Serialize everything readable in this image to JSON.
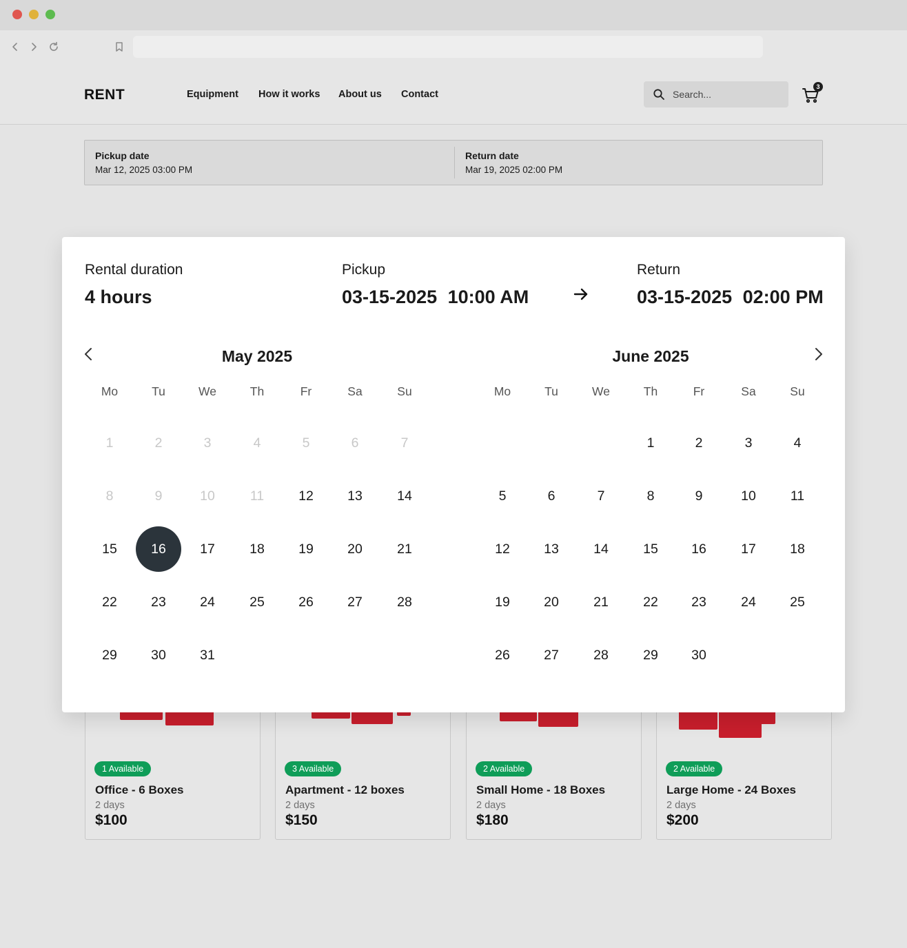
{
  "browser": {
    "colors": {
      "close": "#e0564f",
      "minimize": "#e0b23a",
      "maximize": "#5dbb4f"
    },
    "icons": [
      "back-icon",
      "forward-icon",
      "reload-icon",
      "bookmark-icon"
    ]
  },
  "header": {
    "logo": "RENT",
    "nav": [
      "Equipment",
      "How it works",
      "About us",
      "Contact"
    ],
    "search_placeholder": "Search...",
    "cart_count": "3"
  },
  "booking": {
    "pickup_label": "Pickup date",
    "pickup_value": "Mar 12, 2025 03:00 PM",
    "return_label": "Return date",
    "return_value": "Mar 19, 2025 02:00 PM"
  },
  "picker": {
    "duration_label": "Rental duration",
    "duration_value": "4 hours",
    "pickup_label": "Pickup",
    "pickup_date": "03-15-2025",
    "pickup_time": "10:00 AM",
    "return_label": "Return",
    "return_date": "03-15-2025",
    "return_time": "02:00 PM",
    "weekdays": [
      "Mo",
      "Tu",
      "We",
      "Th",
      "Fr",
      "Sa",
      "Su"
    ],
    "months": [
      {
        "title": "May 2025",
        "first_weekday": 0,
        "days": 31,
        "disabled_through": 11,
        "selected": 16
      },
      {
        "title": "June 2025",
        "first_weekday": 3,
        "days": 30,
        "disabled_through": 0,
        "selected": null
      }
    ],
    "accent_color": "#2b343b"
  },
  "products": [
    {
      "badge": "1 Available",
      "title": "Office - 6 Boxes",
      "duration": "2 days",
      "price": "$100"
    },
    {
      "badge": "3 Available",
      "title": "Apartment - 12 boxes",
      "duration": "2 days",
      "price": "$150"
    },
    {
      "badge": "2 Available",
      "title": "Small Home - 18 Boxes",
      "duration": "2 days",
      "price": "$180"
    },
    {
      "badge": "2 Available",
      "title": "Large Home - 24 Boxes",
      "duration": "2 days",
      "price": "$200"
    }
  ],
  "colors": {
    "badge": "#0f9d58",
    "box": "#c81e2c"
  }
}
